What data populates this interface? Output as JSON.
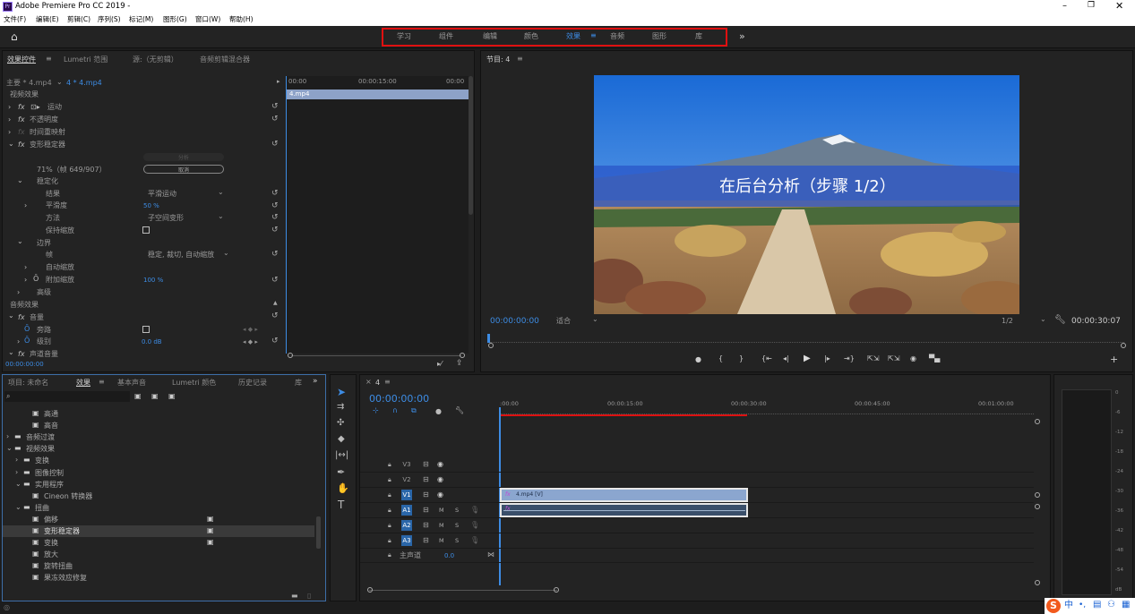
{
  "window": {
    "title": "Adobe Premiere Pro CC 2019 -",
    "app_icon": "Pr"
  },
  "menu": [
    "文件(F)",
    "编辑(E)",
    "剪辑(C)",
    "序列(S)",
    "标记(M)",
    "图形(G)",
    "窗口(W)",
    "帮助(H)"
  ],
  "workspaces": [
    "学习",
    "组件",
    "编辑",
    "颜色",
    "效果",
    "音频",
    "图形",
    "库"
  ],
  "workspace_menu_glyph": "≡",
  "more_glyph": "»",
  "effect_controls": {
    "tabs": [
      "效果控件",
      "Lumetri 范围",
      "源:（无剪辑）",
      "音频剪辑混合器"
    ],
    "tab_menu": "≡",
    "clip_master": "主要 * 4.mp4",
    "clip_seq": "4 * 4.mp4",
    "mini_times": [
      "00:00",
      "00:00:15:00",
      "00:00"
    ],
    "clip_bar": "4.mp4",
    "video_effects": "视频效果",
    "motion": "运动",
    "opacity": "不透明度",
    "time_remap": "时间重映射",
    "warp": "变形稳定器",
    "analyze_btn": "分析",
    "cancel_btn": "取消",
    "progress_text": "71%（帧 649/907）",
    "stabilization": "稳定化",
    "result": "结果",
    "result_value": "平滑运动",
    "smoothness": "平滑度",
    "smoothness_value": "50 %",
    "method": "方法",
    "method_value": "子空间变形",
    "preserve_scale": "保持缩放",
    "borders": "边界",
    "framing": "帧",
    "framing_value": "稳定, 裁切, 自动缩放",
    "auto_scale": "自动缩放",
    "add_scale": "附加缩放",
    "add_scale_value": "100 %",
    "advanced": "高级",
    "audio_effects": "音频效果",
    "volume": "音量",
    "bypass": "旁路",
    "level": "级别",
    "level_value": "0.0 dB",
    "channel_volume": "声道音量",
    "current_time": "00:00:00:00"
  },
  "program": {
    "title": "节目: 4",
    "menu": "≡",
    "overlay_text": "在后台分析（步骤 1/2）",
    "timecode": "00:00:00:00",
    "fit": "适合",
    "resolution": "1/2",
    "duration": "00:00:30:07",
    "controls": [
      "marker-icon",
      "in-point-icon",
      "out-point-icon",
      "go-to-in-icon",
      "step-back-icon",
      "play-icon",
      "step-forward-icon",
      "go-to-out-icon",
      "lift-icon",
      "extract-icon",
      "export-frame-icon",
      "compare-icon"
    ],
    "add_glyph": "+"
  },
  "project": {
    "tabs": [
      "项目: 未命名",
      "效果",
      "基本声音",
      "Lumetri 颜色",
      "历史记录",
      "库"
    ],
    "tab_menu": "≡",
    "more": "»",
    "search_placeholder": "",
    "items": [
      {
        "label": "高通",
        "indent": 2,
        "type": "fx",
        "arrow": ""
      },
      {
        "label": "高音",
        "indent": 2,
        "type": "fx",
        "arrow": ""
      },
      {
        "label": "音频过渡",
        "indent": 0,
        "type": "folder",
        "arrow": "›"
      },
      {
        "label": "视频效果",
        "indent": 0,
        "type": "folder",
        "arrow": "⌄"
      },
      {
        "label": "变换",
        "indent": 1,
        "type": "folder",
        "arrow": "›"
      },
      {
        "label": "图像控制",
        "indent": 1,
        "type": "folder",
        "arrow": "›"
      },
      {
        "label": "实用程序",
        "indent": 1,
        "type": "folder",
        "arrow": "⌄"
      },
      {
        "label": "Cineon 转换器",
        "indent": 2,
        "type": "fx",
        "arrow": ""
      },
      {
        "label": "扭曲",
        "indent": 1,
        "type": "folder",
        "arrow": "⌄"
      },
      {
        "label": "偏移",
        "indent": 2,
        "type": "fx",
        "arrow": "",
        "badge": true
      },
      {
        "label": "变形稳定器",
        "indent": 2,
        "type": "fx",
        "arrow": "",
        "badge": true,
        "selected": true
      },
      {
        "label": "变换",
        "indent": 2,
        "type": "fx",
        "arrow": "",
        "badge": true
      },
      {
        "label": "放大",
        "indent": 2,
        "type": "fx",
        "arrow": ""
      },
      {
        "label": "旋转扭曲",
        "indent": 2,
        "type": "fx",
        "arrow": ""
      },
      {
        "label": "果冻效应修复",
        "indent": 2,
        "type": "fx",
        "arrow": ""
      }
    ]
  },
  "timeline": {
    "tab": "4",
    "tab_menu": "≡",
    "close": "×",
    "timecode": "00:00:00:00",
    "ruler": [
      ":00:00",
      "00:00:15:00",
      "00:00:30:00",
      "00:00:45:00",
      "00:01:00:00"
    ],
    "video_tracks": [
      "V3",
      "V2",
      "V1"
    ],
    "audio_tracks": [
      "A1",
      "A2",
      "A3"
    ],
    "master": "主声道",
    "master_value": "0.0",
    "video_clip": "4.mp4 [V]",
    "ms": [
      "M",
      "S"
    ]
  },
  "meter": {
    "ticks": [
      "0",
      "-6",
      "-12",
      "-18",
      "-24",
      "-30",
      "-36",
      "-42",
      "-48",
      "-54",
      "dB"
    ]
  },
  "taskbar": {
    "ime": "中",
    "punct": "•,"
  }
}
